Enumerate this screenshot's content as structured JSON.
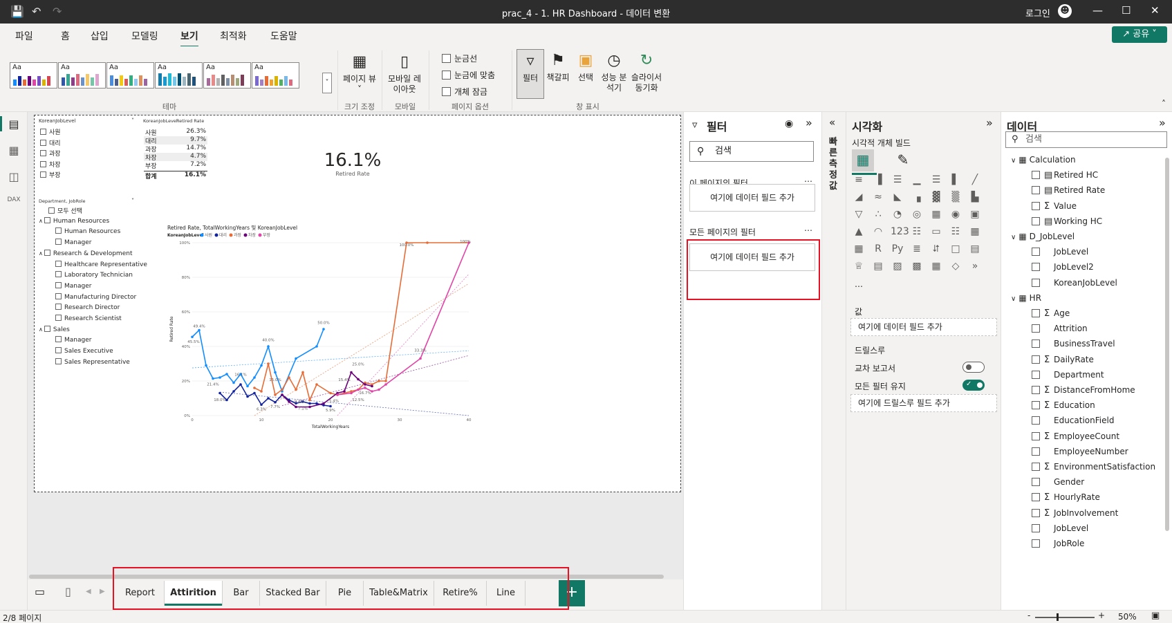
{
  "titlebar": {
    "title": "prac_4 - 1. HR Dashboard - 데이터 변환",
    "signin": "로그인"
  },
  "menu": {
    "items": [
      "파일",
      "홈",
      "삽입",
      "모델링",
      "보기",
      "최적화",
      "도움말"
    ],
    "active": "보기",
    "share": "공유"
  },
  "ribbon": {
    "groups": {
      "theme": "테마",
      "size": "크기 조정",
      "mobile": "모바일",
      "page_options": "페이지 옵션",
      "show_panes": "창 표시"
    },
    "page_view": "페이지 뷰",
    "mobile_layout": "모바일 레이아웃",
    "checks": [
      "눈금선",
      "눈금에 맞춤",
      "개체 잠금"
    ],
    "panes": [
      "필터",
      "책갈피",
      "선택",
      "성능 분석기",
      "슬라이서 동기화"
    ]
  },
  "report": {
    "slicer1": {
      "title": "KoreanJobLevel",
      "items": [
        "사원",
        "대리",
        "과장",
        "차장",
        "부장"
      ]
    },
    "table": {
      "headers": [
        "KoreanJobLevel",
        "Retired Rate"
      ],
      "rows": [
        [
          "사원",
          "26.3%"
        ],
        [
          "대리",
          "9.7%"
        ],
        [
          "과장",
          "14.7%"
        ],
        [
          "차장",
          "4.7%"
        ],
        [
          "부장",
          "7.2%"
        ]
      ],
      "total": [
        "합계",
        "16.1%"
      ]
    },
    "kpi": {
      "value": "16.1%",
      "label": "Retired Rate"
    },
    "slicer2": {
      "title": "Department, JobRole",
      "select_all": "모두 선택",
      "groups": [
        {
          "name": "Human Resources",
          "items": [
            "Human Resources",
            "Manager"
          ]
        },
        {
          "name": "Research & Development",
          "items": [
            "Healthcare Representative",
            "Laboratory Technician",
            "Manager",
            "Manufacturing Director",
            "Research Director",
            "Research Scientist"
          ]
        },
        {
          "name": "Sales",
          "items": [
            "Manager",
            "Sales Executive",
            "Sales Representative"
          ]
        }
      ]
    }
  },
  "chart_data": {
    "type": "line",
    "title": "Retired Rate, TotalWorkingYears 및 KoreanJobLevel",
    "legend_title": "KoreanJobLevel",
    "xlabel": "TotalWorkingYears",
    "ylabel": "Retired Rate",
    "xlim": [
      0,
      40
    ],
    "ylim": [
      0,
      1
    ],
    "xticks": [
      "0",
      "10",
      "20",
      "30",
      "40"
    ],
    "yticks": [
      "0%",
      "20%",
      "40%",
      "60%",
      "80%",
      "100%"
    ],
    "series": [
      {
        "name": "사원",
        "color": "#118DFF",
        "x": [
          0,
          1,
          2,
          3,
          4,
          5,
          6,
          7,
          8,
          9,
          10,
          11,
          12,
          13,
          15,
          18,
          19
        ],
        "y": [
          0.455,
          0.494,
          0.29,
          0.214,
          0.22,
          0.24,
          0.19,
          0.24,
          0.17,
          0.22,
          0.29,
          0.4,
          0.25,
          0.14,
          0.33,
          0.4,
          0.5
        ]
      },
      {
        "name": "대리",
        "color": "#12239E",
        "x": [
          4,
          5,
          6,
          7,
          8,
          9,
          10,
          11,
          12,
          13,
          14,
          15,
          16,
          17,
          18,
          19,
          20
        ],
        "y": [
          0.13,
          0.09,
          0.14,
          0.18,
          0.11,
          0.13,
          0.063,
          0.1,
          0.077,
          0.12,
          0.09,
          0.071,
          0.08,
          0.07,
          0.07,
          0.06,
          0.054
        ]
      },
      {
        "name": "과장",
        "color": "#E66C37",
        "x": [
          9,
          10,
          11,
          12,
          13,
          14,
          15,
          16,
          17,
          18,
          20,
          21,
          22,
          23,
          24,
          25,
          26,
          27,
          28,
          31,
          34,
          40
        ],
        "y": [
          0.16,
          0.14,
          0.3,
          0.12,
          0.15,
          0.22,
          0.15,
          0.25,
          0.09,
          0.18,
          0.13,
          0.12,
          0.13,
          0.14,
          0.15,
          0.19,
          0.18,
          0.2,
          0.2,
          1.0,
          1.0,
          1.0
        ]
      },
      {
        "name": "차장",
        "color": "#6B007B",
        "x": [
          13,
          14,
          15,
          17,
          19,
          21,
          22,
          23,
          24,
          25,
          26
        ],
        "y": [
          0.12,
          0.08,
          0.05,
          0.05,
          0.07,
          0.13,
          0.14,
          0.25,
          0.21,
          0.18,
          0.17
        ]
      },
      {
        "name": "부장",
        "color": "#E044A7",
        "x": [
          21,
          23,
          24,
          25,
          26,
          27,
          28,
          33,
          40
        ],
        "y": [
          0.12,
          0.13,
          0.15,
          0.16,
          0.14,
          0.15,
          0.18,
          0.33,
          1.0
        ]
      }
    ],
    "data_labels": [
      "49.4%",
      "45.5%",
      "21.4%",
      "40.0%",
      "50.0%",
      "18.0%",
      "16.1%",
      "15.0%",
      "6.3%",
      "7.7%",
      "7.1%",
      "9.3%",
      "5.4%",
      "5.9%",
      "15.4%",
      "25.0%",
      "12.5%",
      "16.7%",
      "100.0%",
      "100%",
      "33.3%"
    ]
  },
  "page_tabs": {
    "tabs": [
      "Report",
      "Attirition",
      "Bar",
      "Stacked Bar",
      "Pie",
      "Table&Matrix",
      "Retire%",
      "Line"
    ],
    "active": "Attirition"
  },
  "status": {
    "page": "2/8 페이지",
    "zoom": "50%"
  },
  "filters": {
    "title": "필터",
    "search": "검색",
    "this_page": "이 페이지의 필터",
    "all_pages": "모든 페이지의 필터",
    "add_field": "여기에 데이터 필드 추가"
  },
  "quick_measure": "빠른 측정값",
  "viz": {
    "title": "시각화",
    "build": "시각적 개체 빌드",
    "values": "값",
    "add_field": "여기에 데이터 필드 추가",
    "drillthrough": "드릴스루",
    "cross_report": "교차 보고서",
    "cross_report_state": "off",
    "keep_filters": "모든 필터 유지",
    "keep_filters_state": "on",
    "add_drill": "여기에 드릴스루 필드 추가"
  },
  "data_pane": {
    "title": "데이터",
    "search": "검색",
    "tables": [
      {
        "name": "Calculation",
        "fields": [
          {
            "name": "Retired HC",
            "kind": "measure"
          },
          {
            "name": "Retired Rate",
            "kind": "measure"
          },
          {
            "name": "Value",
            "kind": "sum"
          },
          {
            "name": "Working HC",
            "kind": "measure"
          }
        ]
      },
      {
        "name": "D_JobLevel",
        "fields": [
          {
            "name": "JobLevel",
            "kind": ""
          },
          {
            "name": "JobLevel2",
            "kind": ""
          },
          {
            "name": "KoreanJobLevel",
            "kind": ""
          }
        ]
      },
      {
        "name": "HR",
        "fields": [
          {
            "name": "Age",
            "kind": "sum"
          },
          {
            "name": "Attrition",
            "kind": ""
          },
          {
            "name": "BusinessTravel",
            "kind": ""
          },
          {
            "name": "DailyRate",
            "kind": "sum"
          },
          {
            "name": "Department",
            "kind": ""
          },
          {
            "name": "DistanceFromHome",
            "kind": "sum"
          },
          {
            "name": "Education",
            "kind": "sum"
          },
          {
            "name": "EducationField",
            "kind": ""
          },
          {
            "name": "EmployeeCount",
            "kind": "sum"
          },
          {
            "name": "EmployeeNumber",
            "kind": ""
          },
          {
            "name": "EnvironmentSatisfaction",
            "kind": "sum"
          },
          {
            "name": "Gender",
            "kind": ""
          },
          {
            "name": "HourlyRate",
            "kind": "sum"
          },
          {
            "name": "JobInvolvement",
            "kind": "sum"
          },
          {
            "name": "JobLevel",
            "kind": ""
          },
          {
            "name": "JobRole",
            "kind": ""
          }
        ]
      }
    ]
  }
}
